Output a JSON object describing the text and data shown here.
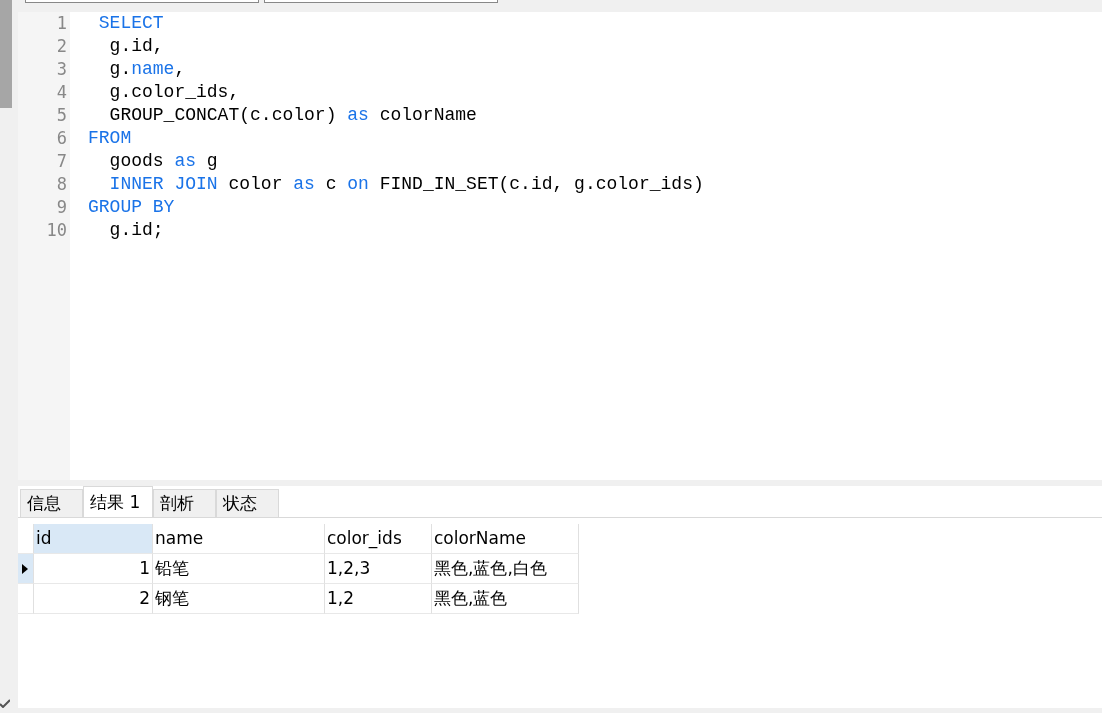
{
  "code_lines": [
    {
      "number": "1",
      "tokens": [
        {
          "text": " SELECT",
          "kind": "keyword"
        }
      ]
    },
    {
      "number": "2",
      "tokens": [
        {
          "text": "  g.id,",
          "kind": "plain"
        }
      ]
    },
    {
      "number": "3",
      "tokens": [
        {
          "text": "  g.",
          "kind": "plain"
        },
        {
          "text": "name",
          "kind": "keyword"
        },
        {
          "text": ",",
          "kind": "plain"
        }
      ]
    },
    {
      "number": "4",
      "tokens": [
        {
          "text": "  g.color_ids,",
          "kind": "plain"
        }
      ]
    },
    {
      "number": "5",
      "tokens": [
        {
          "text": "  GROUP_CONCAT(c.color) ",
          "kind": "plain"
        },
        {
          "text": "as",
          "kind": "keyword"
        },
        {
          "text": " colorName",
          "kind": "plain"
        }
      ]
    },
    {
      "number": "6",
      "tokens": [
        {
          "text": "FROM",
          "kind": "keyword"
        }
      ]
    },
    {
      "number": "7",
      "tokens": [
        {
          "text": "  goods ",
          "kind": "plain"
        },
        {
          "text": "as",
          "kind": "keyword"
        },
        {
          "text": " g",
          "kind": "plain"
        }
      ]
    },
    {
      "number": "8",
      "tokens": [
        {
          "text": "  INNER JOIN",
          "kind": "keyword"
        },
        {
          "text": " color ",
          "kind": "plain"
        },
        {
          "text": "as",
          "kind": "keyword"
        },
        {
          "text": " c ",
          "kind": "plain"
        },
        {
          "text": "on",
          "kind": "keyword"
        },
        {
          "text": " FIND_IN_SET(c.id, g.color_ids)",
          "kind": "plain"
        }
      ]
    },
    {
      "number": "9",
      "tokens": [
        {
          "text": "GROUP BY",
          "kind": "keyword"
        }
      ]
    },
    {
      "number": "10",
      "tokens": [
        {
          "text": "  g.id;",
          "kind": "plain"
        }
      ]
    }
  ],
  "result_tabs": [
    {
      "label": "信息",
      "selected": false
    },
    {
      "label": "结果 1",
      "selected": true
    },
    {
      "label": "剖析",
      "selected": false
    },
    {
      "label": "状态",
      "selected": false
    }
  ],
  "table": {
    "columns": [
      {
        "label": "id",
        "selected": true,
        "kind": "number"
      },
      {
        "label": "name",
        "selected": false,
        "kind": "text"
      },
      {
        "label": "color_ids",
        "selected": false,
        "kind": "text"
      },
      {
        "label": "colorName",
        "selected": false,
        "kind": "text"
      }
    ],
    "rows": [
      {
        "current": true,
        "cells": [
          "1",
          "铅笔",
          "1,2,3",
          "黑色,蓝色,白色"
        ]
      },
      {
        "current": false,
        "cells": [
          "2",
          "钢笔",
          "1,2",
          "黑色,蓝色"
        ]
      }
    ]
  }
}
